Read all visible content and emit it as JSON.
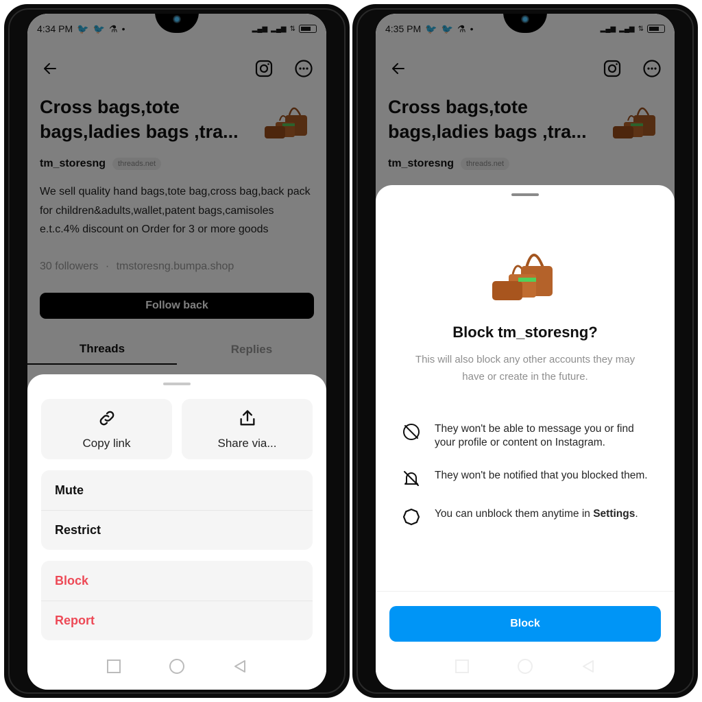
{
  "left_screen": {
    "status_bar": {
      "time": "4:34 PM",
      "icons": [
        "twitter-icon",
        "twitter-icon",
        "flask-icon",
        "dot-icon"
      ],
      "right_icons": [
        "signal-icon",
        "signal-icon",
        "data-icon",
        "battery-icon"
      ]
    },
    "profile": {
      "title": "Cross bags,tote bags,ladies bags ,tra...",
      "username": "tm_storesng",
      "domain_badge": "threads.net",
      "bio": "We sell quality hand bags,tote bag,cross bag,back pack for children&adults,wallet,patent bags,camisoles e.t.c.4% discount on Order for 3 or more goods",
      "followers": "30 followers",
      "separator": "·",
      "link": "tmstoresng.bumpa.shop",
      "follow_button": "Follow back",
      "tabs": [
        {
          "label": "Threads",
          "active": true
        },
        {
          "label": "Replies",
          "active": false
        }
      ]
    },
    "sheet": {
      "quick_actions": [
        {
          "label": "Copy link",
          "icon": "link-icon"
        },
        {
          "label": "Share via...",
          "icon": "share-icon"
        }
      ],
      "group1": [
        "Mute",
        "Restrict"
      ],
      "group2": [
        "Block",
        "Report"
      ]
    },
    "nav": [
      "recents-icon",
      "home-icon",
      "back-icon"
    ]
  },
  "right_screen": {
    "status_bar": {
      "time": "4:35 PM"
    },
    "profile": {
      "title": "Cross bags,tote bags,ladies bags ,tra...",
      "username": "tm_storesng",
      "domain_badge": "threads.net"
    },
    "block_sheet": {
      "title": "Block tm_storesng?",
      "subtitle": "This will also block any other accounts they may have or create in the future.",
      "items": [
        {
          "icon": "message-off-icon",
          "text": "They won't be able to message you or find your profile or content on Instagram."
        },
        {
          "icon": "bell-off-icon",
          "text": "They won't be notified that you blocked them."
        },
        {
          "icon": "settings-gear-icon",
          "text": "You can unblock them anytime in ",
          "bold": "Settings",
          "tail": "."
        }
      ],
      "button": "Block"
    }
  },
  "colors": {
    "danger": "#ed4956",
    "primary": "#0095f6"
  }
}
